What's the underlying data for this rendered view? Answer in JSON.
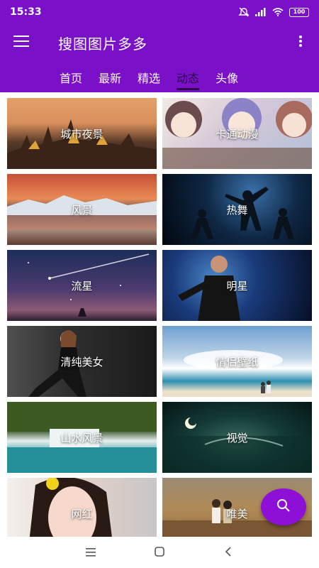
{
  "status_bar": {
    "time": "15:33",
    "battery": "100",
    "icons": [
      "mute-icon",
      "signal-icon",
      "wifi-icon",
      "battery-icon"
    ]
  },
  "app_bar": {
    "title": "搜图图片多多",
    "menu_icon": "hamburger-icon",
    "more_icon": "more-vert-icon"
  },
  "tabs": [
    {
      "label": "首页",
      "active": false
    },
    {
      "label": "最新",
      "active": false
    },
    {
      "label": "精选",
      "active": false
    },
    {
      "label": "动态",
      "active": true
    },
    {
      "label": "头像",
      "active": false
    }
  ],
  "categories": [
    {
      "label": "城市夜景"
    },
    {
      "label": "卡通动漫"
    },
    {
      "label": "风景"
    },
    {
      "label": "热舞"
    },
    {
      "label": "流星"
    },
    {
      "label": "明星"
    },
    {
      "label": "清纯美女"
    },
    {
      "label": "情侣壁纸"
    },
    {
      "label": "山水风景"
    },
    {
      "label": "视觉"
    },
    {
      "label": "网红"
    },
    {
      "label": "唯美"
    }
  ],
  "fab": {
    "icon": "search-icon"
  },
  "nav_bar": {
    "icons": [
      "recents-icon",
      "home-icon",
      "back-icon"
    ]
  },
  "colors": {
    "primary": "#7a10c8",
    "fab": "#8e10d6",
    "active_tab": "#2b0a45"
  }
}
